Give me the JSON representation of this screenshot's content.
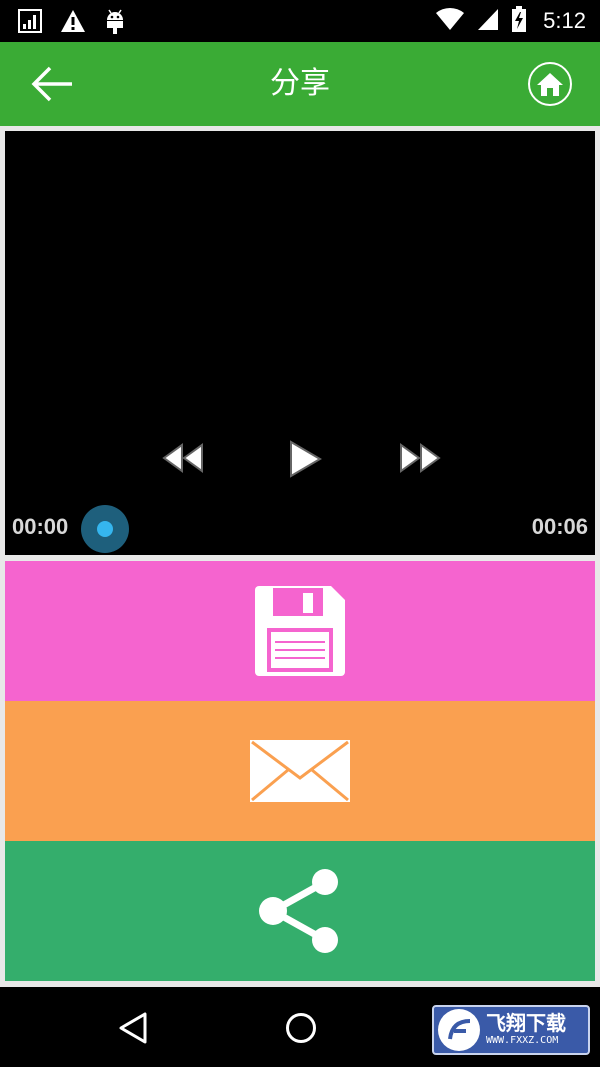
{
  "status_bar": {
    "time": "5:12",
    "icons": [
      "signal-box-icon",
      "warning-icon",
      "android-icon",
      "wifi-icon",
      "cell-signal-icon",
      "battery-charging-icon"
    ]
  },
  "app_bar": {
    "title": "分享",
    "back_icon": "arrow-left-icon",
    "home_icon": "home-icon"
  },
  "player": {
    "current_time": "00:00",
    "total_time": "00:06",
    "progress": 0,
    "controls": [
      "rewind-icon",
      "play-icon",
      "fast-forward-icon"
    ]
  },
  "actions": [
    {
      "name": "save",
      "icon": "floppy-disk-icon",
      "color": "#f564cf"
    },
    {
      "name": "email",
      "icon": "envelope-icon",
      "color": "#faa050"
    },
    {
      "name": "share",
      "icon": "share-icon",
      "color": "#34ae6c"
    }
  ],
  "nav_bar": {
    "icons": [
      "nav-back-icon",
      "nav-home-icon"
    ]
  },
  "watermark": {
    "title": "飞翔下载",
    "url": "WWW.FXXZ.COM"
  },
  "colors": {
    "app_bar": "#3aab35",
    "seek_knob": "#1e5f7c",
    "seek_dot": "#35b6ef"
  }
}
